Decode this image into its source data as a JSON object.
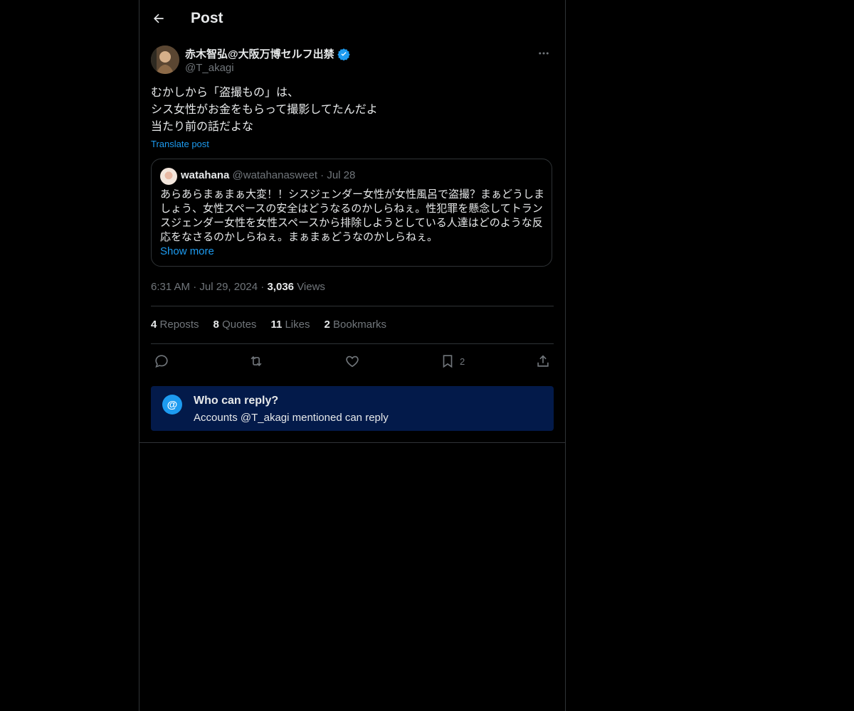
{
  "header": {
    "title": "Post"
  },
  "post": {
    "author_name": "赤木智弘@大阪万博セルフ出禁",
    "author_handle": "@T_akagi",
    "text": "むかしから「盗撮もの」は、\nシス女性がお金をもらって撮影してたんだよ\n当たり前の話だよな",
    "translate_label": "Translate post",
    "quote": {
      "name": "watahana",
      "handle": "@watahanasweet",
      "separator": "·",
      "date": "Jul 28",
      "text": "あらあらまぁまぁ大変！！シスジェンダー女性が女性風呂で盗撮？まぁどうしましょう、女性スペースの安全はどうなるのかしらねぇ。性犯罪を懸念してトランスジェンダー女性を女性スペースから排除しようとしている人達はどのような反応をなさるのかしらねぇ。まぁまぁどうなのかしらねぇ。",
      "show_more": "Show more"
    },
    "time": "6:31 AM",
    "dot": "·",
    "date": "Jul 29, 2024",
    "views_count": "3,036",
    "views_label": "Views",
    "stats": [
      {
        "count": "4",
        "label": "Reposts"
      },
      {
        "count": "8",
        "label": "Quotes"
      },
      {
        "count": "11",
        "label": "Likes"
      },
      {
        "count": "2",
        "label": "Bookmarks"
      }
    ],
    "bookmark_count": "2"
  },
  "reply_notice": {
    "icon_glyph": "@",
    "title": "Who can reply?",
    "subtitle": "Accounts @T_akagi mentioned can reply"
  },
  "colors": {
    "accent": "#1d9bf0",
    "background": "#000000",
    "reply_box": "#031a4a",
    "muted_text": "#71767b"
  },
  "icons": [
    "back-arrow-icon",
    "verified-badge-icon",
    "more-icon",
    "reply-icon",
    "repost-icon",
    "like-icon",
    "bookmark-icon",
    "share-icon"
  ]
}
